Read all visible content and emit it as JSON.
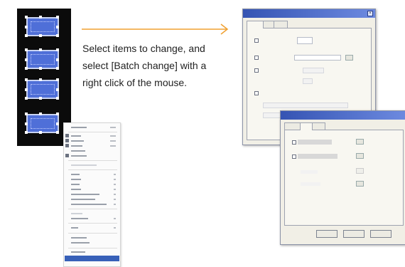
{
  "instruction": {
    "lines": [
      "Select items to change, and",
      "select [Batch change] with a",
      "right click of the mouse."
    ]
  },
  "colors": {
    "accent_arrow": "#f0a030",
    "canvas_bg": "#0b0b0b",
    "tile_fill": "#4f6fd8",
    "menu_highlight": "#3760b8"
  },
  "icons": {
    "close": "close-icon",
    "arrow": "right-arrow-icon"
  }
}
